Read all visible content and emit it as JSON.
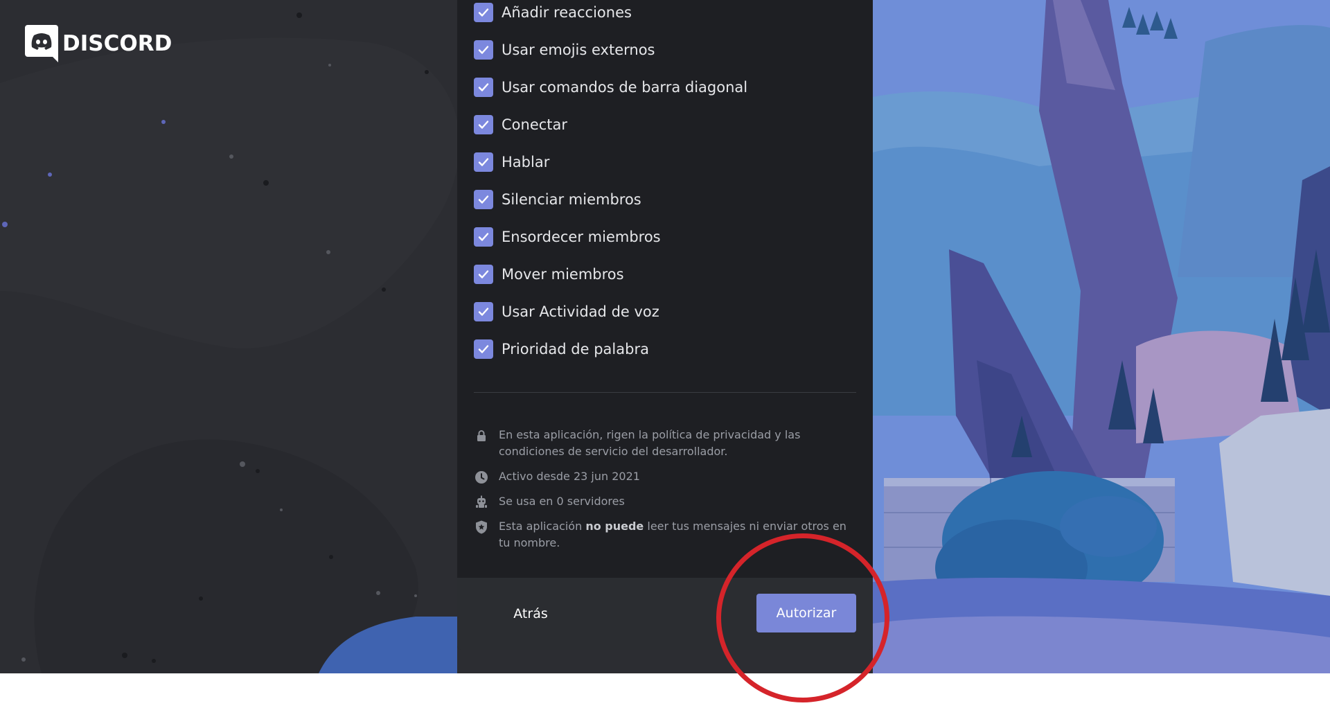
{
  "brand": {
    "wordmark": "DISCORD",
    "icon": "discord-logo-icon"
  },
  "permissions": [
    {
      "label": "Añadir reacciones",
      "checked": true
    },
    {
      "label": "Usar emojis externos",
      "checked": true
    },
    {
      "label": "Usar comandos de barra diagonal",
      "checked": true
    },
    {
      "label": "Conectar",
      "checked": true
    },
    {
      "label": "Hablar",
      "checked": true
    },
    {
      "label": "Silenciar miembros",
      "checked": true
    },
    {
      "label": "Ensordecer miembros",
      "checked": true
    },
    {
      "label": "Mover miembros",
      "checked": true
    },
    {
      "label": "Usar Actividad de voz",
      "checked": true
    },
    {
      "label": "Prioridad de palabra",
      "checked": true
    }
  ],
  "info": {
    "privacy": {
      "icon": "lock-icon",
      "text": "En esta aplicación, rigen la política de privacidad y las condiciones de servicio del desarrollador."
    },
    "active": {
      "icon": "clock-icon",
      "text": "Activo desde 23 jun 2021"
    },
    "servers": {
      "icon": "robot-icon",
      "text": "Se usa en 0 servidores"
    },
    "messages": {
      "icon": "shield-icon",
      "text_before": "Esta aplicación ",
      "text_bold": "no puede",
      "text_after": " leer tus mensajes ni enviar otros en tu nombre."
    }
  },
  "footer": {
    "back_label": "Atrás",
    "authorize_label": "Autorizar"
  },
  "colors": {
    "accent": "#7a87d8",
    "checkbox": "#7c88de",
    "modal_bg": "#1e1f23",
    "footer_bg": "#2b2d31",
    "highlight": "#d5242a"
  }
}
